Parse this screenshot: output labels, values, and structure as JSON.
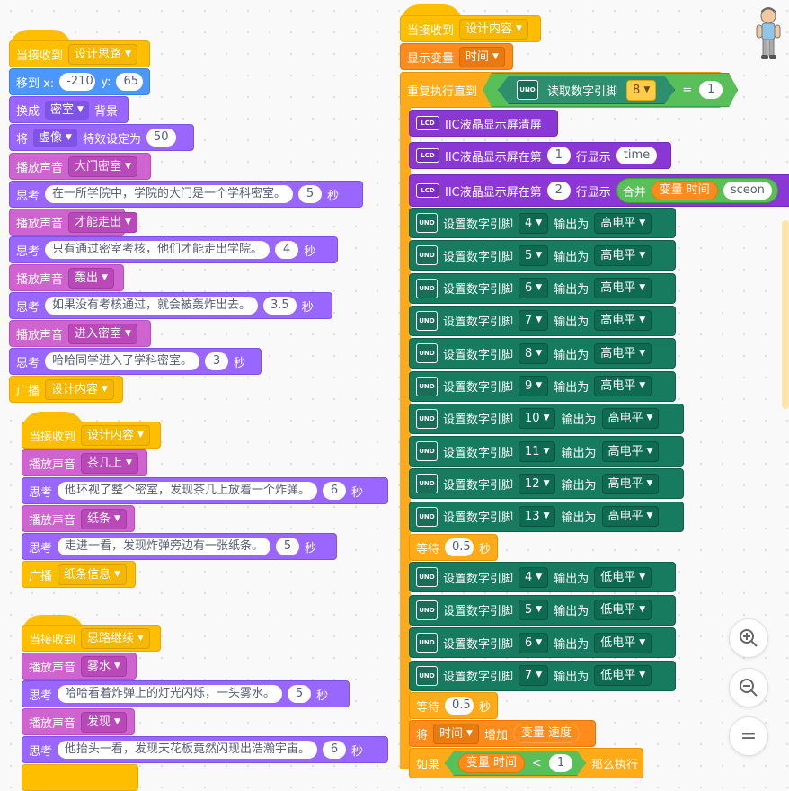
{
  "labels": {
    "when_receive": "当接收到",
    "goto_x": "移到 x:",
    "goto_y": "y:",
    "switch": "换成",
    "backdrop": "背景",
    "set": "将",
    "effect_to": "特效设定为",
    "play_sound": "播放声音",
    "think": "思考",
    "sec": "秒",
    "broadcast": "广播",
    "show_var": "显示变量",
    "repeat_until": "重复执行直到",
    "read_digital": "读取数字引脚",
    "eq": "=",
    "lcd_clear": "IIC液晶显示屏清屏",
    "lcd_row": "IIC液晶显示屏在第",
    "row_show": "行显示",
    "join": "合并",
    "var_word": "变量",
    "set_digital": "设置数字引脚",
    "output": "输出为",
    "wait": "等待",
    "increase": "增加",
    "if": "如果",
    "lt": "<",
    "then": "那么执行",
    "uno": "UNO",
    "lcd_icon": "LCD"
  },
  "stack1": {
    "msg": "设计思路",
    "x": "-210",
    "y": "65",
    "backdrop": "密室",
    "effect": "虚像",
    "effect_val": "50",
    "items": [
      {
        "type": "sound",
        "v": "大门密室"
      },
      {
        "type": "think",
        "v": "在一所学院中，学院的大门是一个学科密室。",
        "t": "5"
      },
      {
        "type": "sound",
        "v": "才能走出"
      },
      {
        "type": "think",
        "v": "只有通过密室考核，他们才能走出学院。",
        "t": "4"
      },
      {
        "type": "sound",
        "v": "轰出"
      },
      {
        "type": "think",
        "v": "如果没有考核通过，就会被轰炸出去。",
        "t": "3.5"
      },
      {
        "type": "sound",
        "v": "进入密室"
      },
      {
        "type": "think",
        "v": "哈哈同学进入了学科密室。",
        "t": "3"
      }
    ],
    "broadcast": "设计内容"
  },
  "stack2": {
    "msg": "设计内容",
    "items": [
      {
        "type": "sound",
        "v": "茶几上"
      },
      {
        "type": "think",
        "v": "他环视了整个密室，发现茶几上放着一个炸弹。",
        "t": "6"
      },
      {
        "type": "sound",
        "v": "纸条"
      },
      {
        "type": "think",
        "v": "走进一看，发现炸弹旁边有一张纸条。",
        "t": "5"
      }
    ],
    "broadcast": "纸条信息"
  },
  "stack3": {
    "msg": "思路继续",
    "items": [
      {
        "type": "sound",
        "v": "雾水"
      },
      {
        "type": "think",
        "v": "哈哈看着炸弹上的灯光闪烁，一头雾水。",
        "t": "5"
      },
      {
        "type": "sound",
        "v": "发现"
      },
      {
        "type": "think",
        "v": "他抬头一看，发现天花板竟然闪现出浩瀚宇宙。",
        "t": "6"
      }
    ]
  },
  "stack4": {
    "msg": "设计内容",
    "show_var": "时间",
    "read_pin": "8",
    "eq_val": "1",
    "lcd1_row": "1",
    "lcd1_text": "time",
    "lcd2_row": "2",
    "lcd2_var": "时间",
    "lcd2_text": "sceon",
    "pins_high": [
      {
        "pin": "4",
        "level": "高电平"
      },
      {
        "pin": "5",
        "level": "高电平"
      },
      {
        "pin": "6",
        "level": "高电平"
      },
      {
        "pin": "7",
        "level": "高电平"
      },
      {
        "pin": "8",
        "level": "高电平"
      },
      {
        "pin": "9",
        "level": "高电平"
      },
      {
        "pin": "10",
        "level": "高电平"
      },
      {
        "pin": "11",
        "level": "高电平"
      },
      {
        "pin": "12",
        "level": "高电平"
      },
      {
        "pin": "13",
        "level": "高电平"
      }
    ],
    "wait1": "0.5",
    "pins_low": [
      {
        "pin": "4",
        "level": "低电平"
      },
      {
        "pin": "5",
        "level": "低电平"
      },
      {
        "pin": "6",
        "level": "低电平"
      },
      {
        "pin": "7",
        "level": "低电平"
      }
    ],
    "wait2": "0.5",
    "change_var": "时间",
    "change_by_var": "速度",
    "if_var": "时间",
    "if_val": "1"
  },
  "zoom": {
    "in": "zoom-in",
    "out": "zoom-out",
    "reset": "="
  }
}
